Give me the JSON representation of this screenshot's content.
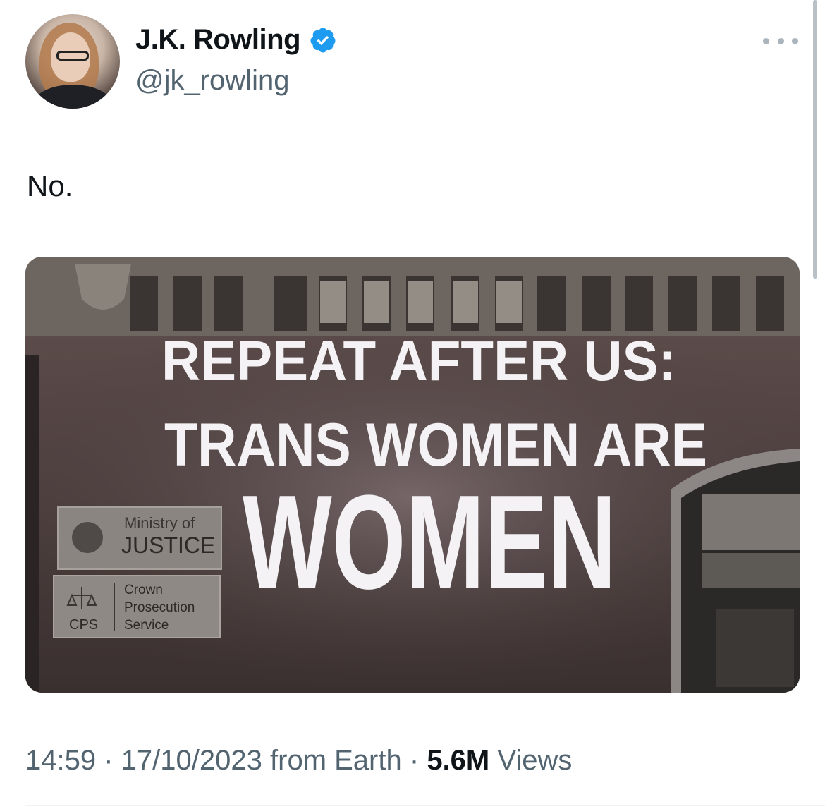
{
  "author": {
    "name": "J.K. Rowling",
    "handle": "@jk_rowling",
    "verified": true
  },
  "icons": {
    "avatar": "profile-photo",
    "verified": "verified-badge-icon",
    "more": "more-options-icon"
  },
  "tweet": {
    "text": "No."
  },
  "media": {
    "projection_lines": [
      "REPEAT AFTER US:",
      "TRANS WOMEN ARE",
      "WOMEN"
    ],
    "sign_ministry_line1": "Ministry of",
    "sign_ministry_line2": "JUSTICE",
    "sign_cps_abbr": "CPS",
    "sign_cps_line1": "Crown",
    "sign_cps_line2": "Prosecution",
    "sign_cps_line3": "Service"
  },
  "meta": {
    "time": "14:59",
    "separator": "·",
    "date": "17/10/2023",
    "source": "from Earth",
    "views_count": "5.6M",
    "views_label": "Views"
  },
  "colors": {
    "text_primary": "#0f1419",
    "text_secondary": "#536471",
    "verified_blue": "#1d9bf0"
  }
}
